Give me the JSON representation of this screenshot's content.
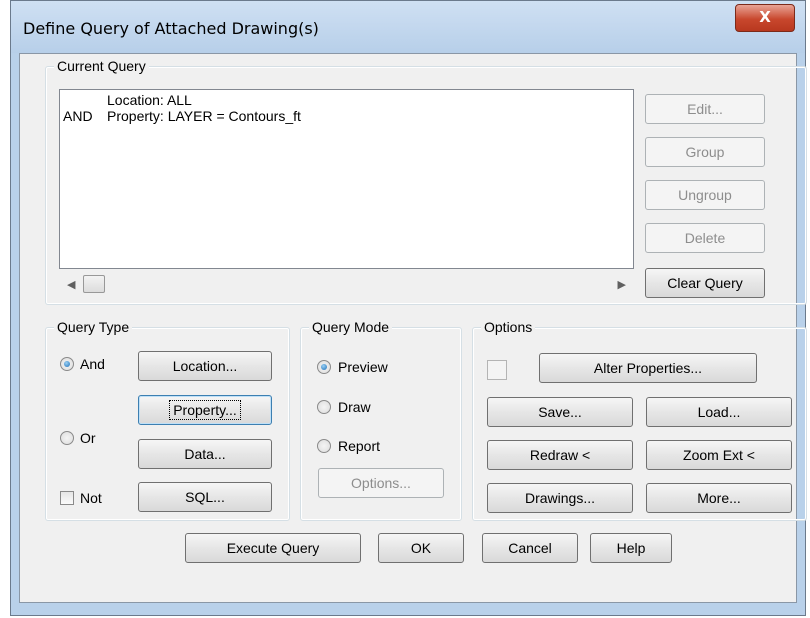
{
  "window": {
    "title": "Define Query of Attached Drawing(s)",
    "close_label": "X"
  },
  "current_query": {
    "group_label": "Current Query",
    "lines": [
      {
        "prefix": "",
        "text": "Location: ALL"
      },
      {
        "prefix": "AND",
        "text": "Property: LAYER = Contours_ft"
      }
    ],
    "buttons": {
      "edit": "Edit...",
      "group": "Group",
      "ungroup": "Ungroup",
      "delete": "Delete",
      "clear": "Clear Query"
    },
    "scroll_left": "◀",
    "scroll_right": "▶"
  },
  "query_type": {
    "group_label": "Query Type",
    "and_label": "And",
    "or_label": "Or",
    "not_label": "Not",
    "selected": "And",
    "buttons": {
      "location": "Location...",
      "property": "Property...",
      "data": "Data...",
      "sql": "SQL..."
    }
  },
  "query_mode": {
    "group_label": "Query Mode",
    "preview_label": "Preview",
    "draw_label": "Draw",
    "report_label": "Report",
    "selected": "Preview",
    "options_button": "Options..."
  },
  "options": {
    "group_label": "Options",
    "alter_properties": "Alter Properties...",
    "save": "Save...",
    "load": "Load...",
    "redraw": "Redraw <",
    "zoom_ext": "Zoom Ext <",
    "drawings": "Drawings...",
    "more": "More..."
  },
  "footer": {
    "execute": "Execute Query",
    "ok": "OK",
    "cancel": "Cancel",
    "help": "Help"
  },
  "colors": {
    "title_bar": "#b9d1ea",
    "close_button": "#c8472d",
    "dialog_bg": "#f0f0f0",
    "radio_selected": "#1d6fb8"
  }
}
